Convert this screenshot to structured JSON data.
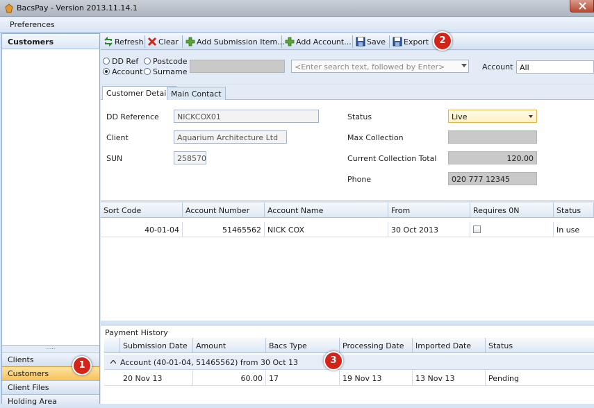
{
  "window": {
    "title": "BacsPay - Version 2013.11.14.1"
  },
  "menu": {
    "preferences": "Preferences"
  },
  "nav": {
    "header": "Customers",
    "grip": ".....",
    "items": [
      {
        "label": "Clients"
      },
      {
        "label": "Customers"
      },
      {
        "label": "Client Files"
      },
      {
        "label": "Holding Area"
      }
    ]
  },
  "toolbar": {
    "refresh": "Refresh",
    "clear": "Clear",
    "add_submission": "Add Submission Item...",
    "add_account": "Add Account...",
    "save": "Save",
    "export": "Export"
  },
  "search": {
    "options": [
      "DD Ref",
      "Postcode",
      "Account",
      "Surname"
    ],
    "selected": "Account",
    "placeholder": "<Enter search text, followed by Enter>",
    "account_label": "Account",
    "account_value": "All"
  },
  "tabs": [
    "Customer Details",
    "Main Contact"
  ],
  "details": {
    "dd_reference_label": "DD Reference",
    "dd_reference": "NICKCOX01",
    "client_label": "Client",
    "client": "Aquarium Architecture Ltd",
    "sun_label": "SUN",
    "sun": "258570",
    "status_label": "Status",
    "status": "Live",
    "max_collection_label": "Max Collection",
    "max_collection": "",
    "current_total_label": "Current Collection Total",
    "current_total": "120.00",
    "phone_label": "Phone",
    "phone": "020 777 12345"
  },
  "accounts": {
    "columns": [
      "Sort Code",
      "Account Number",
      "Account Name",
      "From",
      "Requires 0N",
      "Status"
    ],
    "rows": [
      {
        "sort_code": "40-01-04",
        "account_number": "51465562",
        "account_name": "NICK COX",
        "from": "30 Oct 2013",
        "requires_0n": false,
        "status": "In use"
      }
    ]
  },
  "payment_history": {
    "title": "Payment History",
    "columns": [
      "Submission Date",
      "Amount",
      "Bacs Type",
      "Processing Date",
      "Imported Date",
      "Status"
    ],
    "group": "Account (40-01-04, 51465562) from 30 Oct 13",
    "rows": [
      {
        "submission_date": "20 Nov 13",
        "amount": "60.00",
        "bacs_type": "17",
        "processing_date": "19 Nov 13",
        "imported_date": "13 Nov 13",
        "status": "Pending"
      }
    ]
  },
  "callouts": [
    "1",
    "2",
    "3"
  ],
  "colors": {
    "accent": "#d3241a",
    "selected_nav": "#f7c25a",
    "panel": "#d6e4f3"
  }
}
